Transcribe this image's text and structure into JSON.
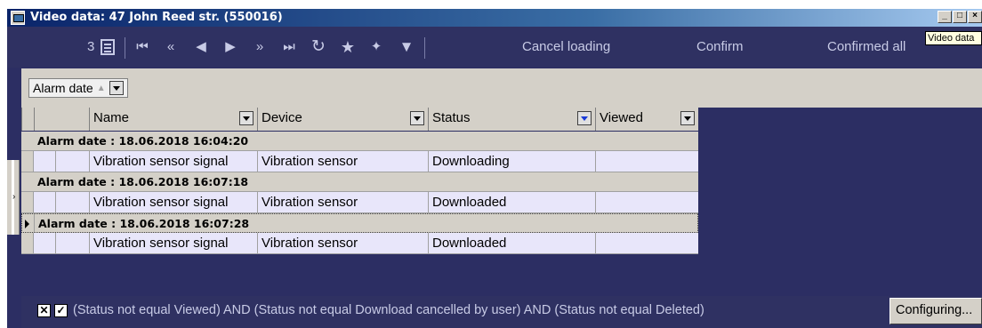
{
  "window": {
    "title": "Video data: 47 John Reed str. (550016)",
    "tooltip": "Video data",
    "controls": {
      "minimize": "_",
      "maximize": "□",
      "close": "×"
    }
  },
  "toolbar": {
    "count": "3",
    "icons": [
      "table-view-icon",
      "first-icon",
      "previous-page-icon",
      "previous-icon",
      "next-icon",
      "next-page-icon",
      "last-icon",
      "refresh-icon",
      "star-icon",
      "star-add-icon",
      "filter-icon"
    ],
    "glyphs": {
      "first": "⏮",
      "prev_page": "«",
      "prev": "◀",
      "next": "▶",
      "next_page": "»",
      "last": "⏭",
      "refresh": "↻",
      "star": "★",
      "star_add": "✦",
      "filter": "▼"
    },
    "cancel_loading": "Cancel loading",
    "confirm": "Confirm",
    "confirmed_all": "Confirmed all"
  },
  "grouping": {
    "field": "Alarm date",
    "sort_glyph": "▲"
  },
  "columns": [
    {
      "label": "Name"
    },
    {
      "label": "Device"
    },
    {
      "label": "Status"
    },
    {
      "label": "Viewed"
    }
  ],
  "groups": [
    {
      "label": "Alarm date : 18.06.2018 16:04:20",
      "rows": [
        {
          "name": "Vibration sensor signal",
          "device": "Vibration sensor",
          "status": "Downloading",
          "viewed": ""
        }
      ]
    },
    {
      "label": "Alarm date : 18.06.2018 16:07:18",
      "rows": [
        {
          "name": "Vibration sensor signal",
          "device": "Vibration sensor",
          "status": "Downloaded",
          "viewed": ""
        }
      ]
    },
    {
      "label": "Alarm date : 18.06.2018 16:07:28",
      "rows": [
        {
          "name": "Vibration sensor signal",
          "device": "Vibration sensor",
          "status": "Downloaded",
          "viewed": ""
        }
      ]
    }
  ],
  "footer": {
    "filter_text": "(Status not equal Viewed) AND (Status not equal Download cancelled by user) AND (Status not equal Deleted)",
    "clear_glyph": "✕",
    "enabled_glyph": "✓",
    "configuring": "Configuring..."
  },
  "colors": {
    "background": "#2c2e63",
    "toolbar_text": "#c8cbe6",
    "row_fill": "#e8e6fa",
    "group_fill": "#d4d0c8"
  }
}
